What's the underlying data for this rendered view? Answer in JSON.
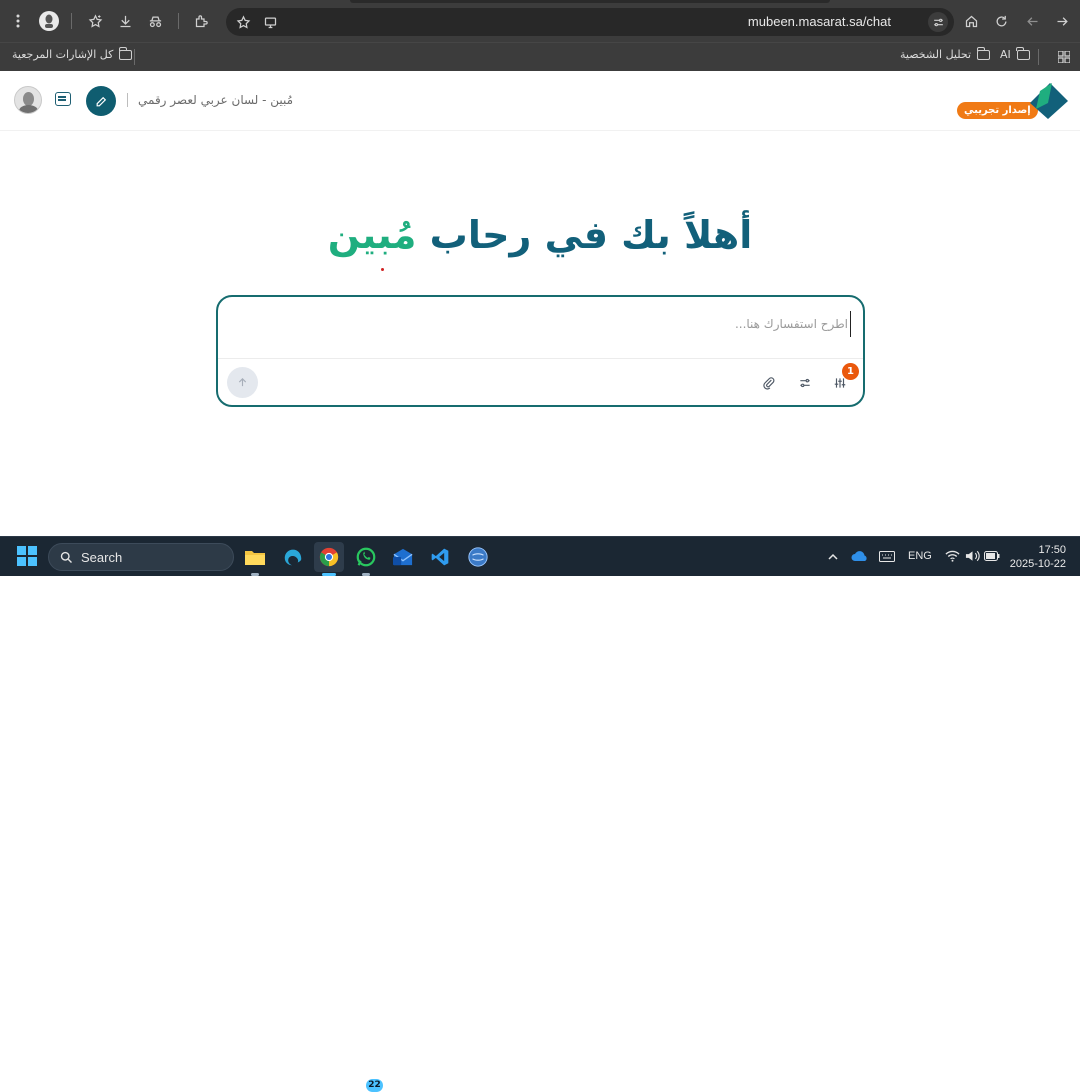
{
  "browser": {
    "url": "mubeen.masarat.sa/chat",
    "bookmarks": [
      {
        "label": "كل الإشارات المرجعية"
      },
      {
        "label": "تحليل الشخصية"
      },
      {
        "label": "AI"
      }
    ],
    "icons": [
      "kebab-menu-icon",
      "avatar-icon",
      "star-icon",
      "download-icon",
      "extension-icon",
      "puzzle-icon",
      "bookmark-star-icon",
      "cast-icon",
      "site-settings-icon",
      "home-icon",
      "reload-icon",
      "back-icon",
      "forward-icon",
      "apps-grid-icon"
    ]
  },
  "header": {
    "title": "مُبين - لسان عربي لعصر رقمي",
    "beta_badge": "إصدار تجريبي"
  },
  "main": {
    "headline_part1": "أهلاً بك في رحاب",
    "headline_part2": "مُبين",
    "colors": {
      "primary": "#12607a",
      "accent": "#1fae7f",
      "badge": "#f07a15"
    }
  },
  "chatbox": {
    "placeholder": "اطرح استفسارك هنا...",
    "value": "",
    "filter_badge": "1"
  },
  "taskbar": {
    "search_label": "Search",
    "whatsapp_badge": "22",
    "language": "ENG",
    "time": "17:50",
    "date": "2025-10-22"
  }
}
